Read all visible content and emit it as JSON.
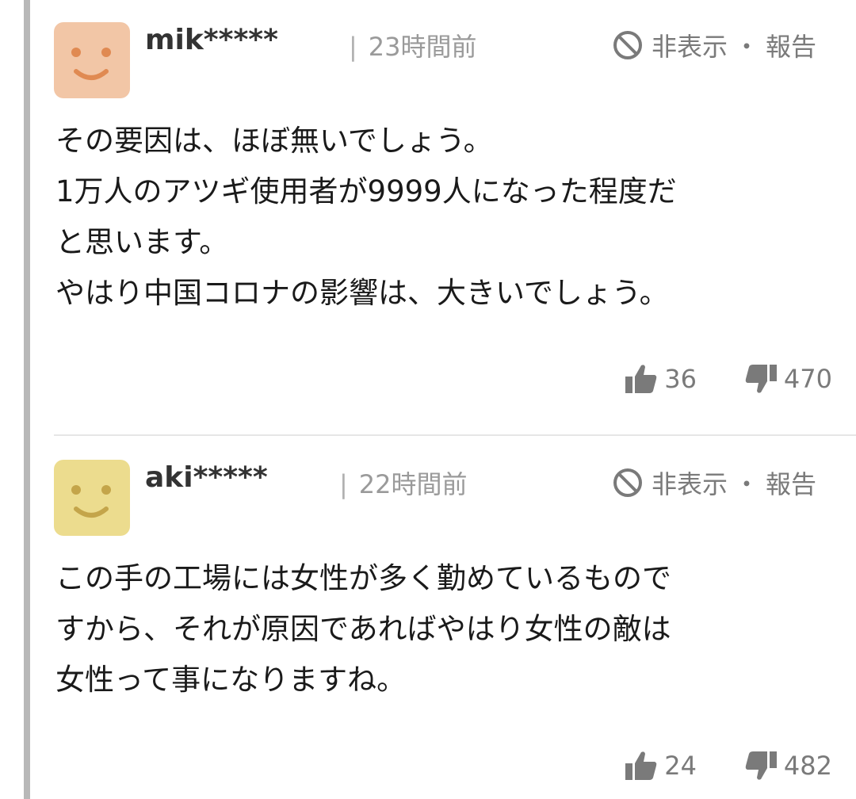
{
  "comments": [
    {
      "author": "mik*****",
      "time": "23時間前",
      "hide_label": "非表示",
      "report_label": "報告",
      "separator": "・",
      "body": [
        "その要因は、ほぼ無いでしょう。",
        "1万人のアツギ使用者が9999人になった程度だ",
        "と思います。",
        "やはり中国コロナの影響は、大きいでしょう。"
      ],
      "likes": "36",
      "dislikes": "470",
      "avatar_color": "#f2c6a6",
      "avatar_face_color": "#e08a52"
    },
    {
      "author": "aki*****",
      "time": "22時間前",
      "hide_label": "非表示",
      "report_label": "報告",
      "separator": "・",
      "body": [
        "この手の工場には女性が多く勤めているもので",
        "すから、それが原因であればやはり女性の敵は",
        "女性って事になりますね。"
      ],
      "likes": "24",
      "dislikes": "482",
      "avatar_color": "#ecdc8e",
      "avatar_face_color": "#c4a54a"
    }
  ],
  "divider_bar": "|",
  "colors": {
    "thread_line": "#b8b8b8",
    "meta_text": "#9a9a9a",
    "action_text": "#7a7a7a"
  },
  "icons": {
    "avatar": "smiley-face-icon",
    "hide": "ban-circle-icon",
    "like": "thumbs-up-icon",
    "dislike": "thumbs-down-icon"
  }
}
